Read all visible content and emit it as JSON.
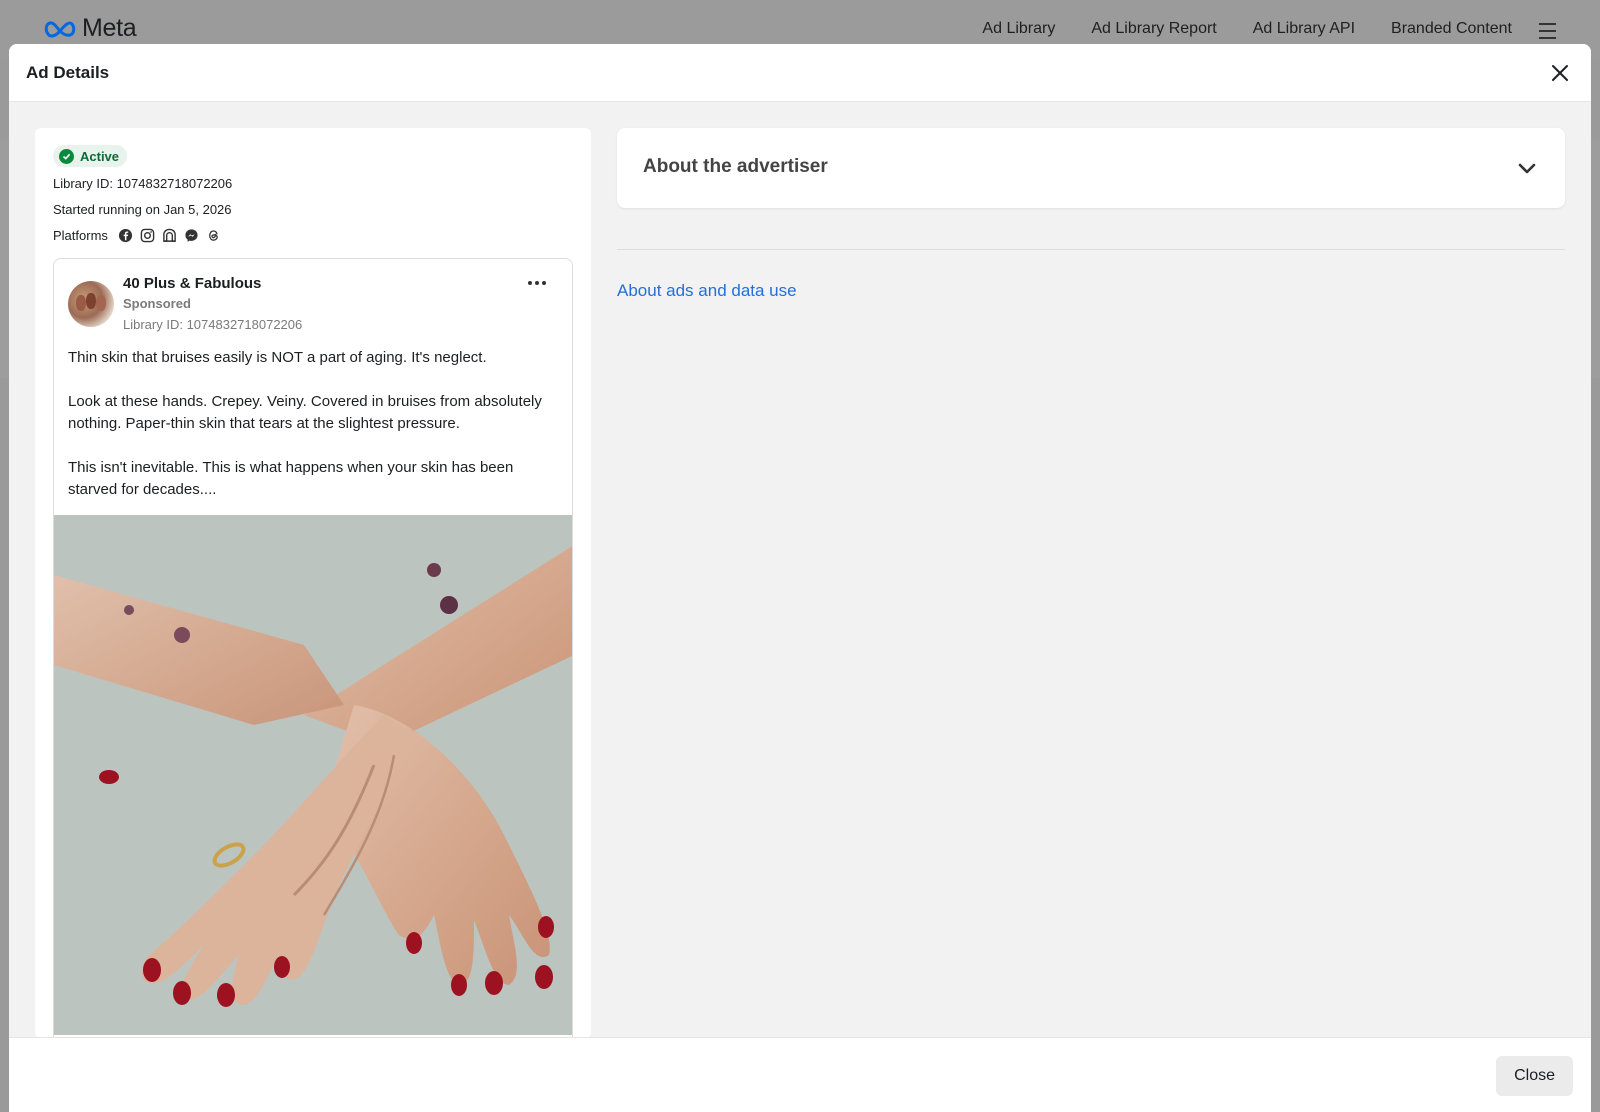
{
  "brand": {
    "name": "Meta"
  },
  "topnav": {
    "items": [
      "Ad Library",
      "Ad Library Report",
      "Ad Library API",
      "Branded Content"
    ]
  },
  "modal": {
    "title": "Ad Details",
    "close_label": "Close"
  },
  "ad": {
    "status": "Active",
    "library_id_line": "Library ID: 1074832718072206",
    "started_line": "Started running on Jan 5, 2026",
    "platforms_label": "Platforms",
    "platform_icons": [
      "facebook-icon",
      "instagram-icon",
      "audience-network-icon",
      "messenger-icon",
      "threads-icon"
    ],
    "advertiser": "40 Plus & Fabulous",
    "sponsored": "Sponsored",
    "card_library_id": "Library ID: 1074832718072206",
    "body": [
      "Thin skin that bruises easily is NOT a part of aging. It's neglect.",
      "Look at these hands. Crepey. Veiny. Covered in bruises from absolutely nothing. Paper-thin skin that tears at the slightest pressure.",
      "This isn't inevitable. This is what happens when your skin has been starved for decades...."
    ]
  },
  "right": {
    "about_advertiser": "About the advertiser",
    "about_ads_link": "About ads and data use"
  },
  "colors": {
    "status_green": "#0b8a3e",
    "link_blue": "#216fdb",
    "meta_blue": "#0668e1"
  }
}
